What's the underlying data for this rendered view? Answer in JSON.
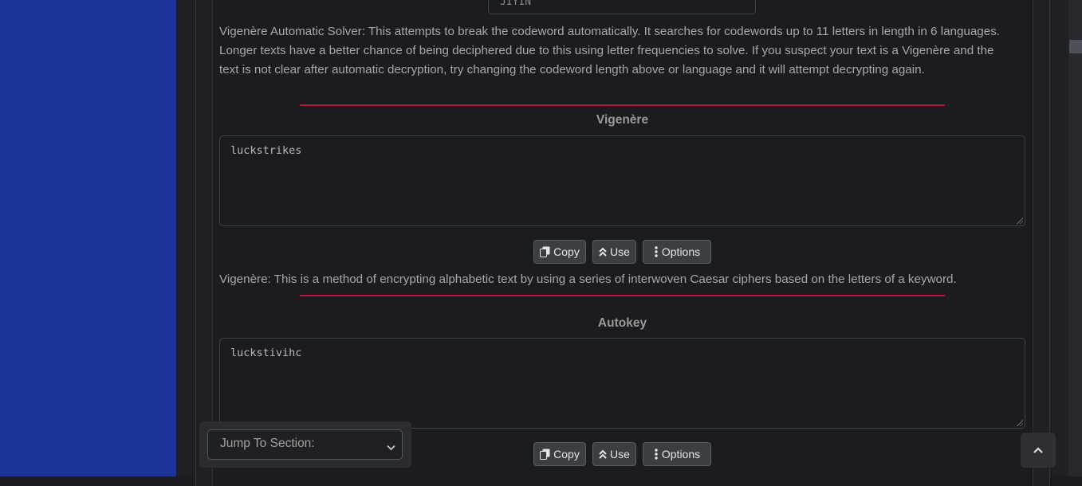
{
  "codeword_box": {
    "value": "JIYIN"
  },
  "solver": {
    "description": "Vigenère Automatic Solver: This attempts to break the codeword automatically. It searches for codewords up to 11 letters in length in 6 languages. Longer texts have a better chance of being deciphered due to this using letter frequencies to solve. If you suspect your text is a Vigenère and the text is not clear after automatic decryption, try changing the codeword length above or language and it will attempt decrypting again."
  },
  "vigenere": {
    "title": "Vigenère",
    "output": "luckstrikes",
    "description": "Vigenère: This is a method of encrypting alphabetic text by using a series of interwoven Caesar ciphers based on the letters of a keyword."
  },
  "autokey": {
    "title": "Autokey",
    "output": "luckstivihc"
  },
  "buttons": {
    "copy": "Copy",
    "use": "Use",
    "options": "Options"
  },
  "jump": {
    "selected": "Jump To Section:"
  },
  "icons": {
    "copy": "copy-icon",
    "use": "double-chevron-up-icon",
    "options": "vertical-ellipsis-icon",
    "back_to_top": "chevron-up-icon",
    "select": "chevron-down-icon"
  },
  "colors": {
    "sidebar": "#1c3399",
    "divider": "#b3163a",
    "background": "#1b1c1f"
  }
}
